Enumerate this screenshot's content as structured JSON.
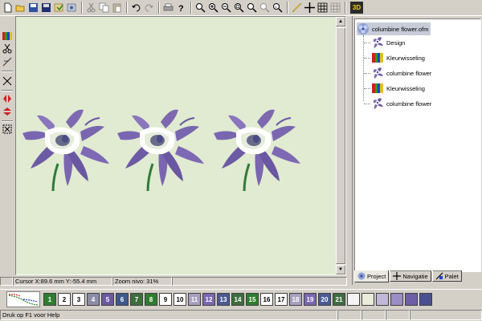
{
  "toolbar": {
    "buttons": [
      "new-icon",
      "open-icon",
      "save-as-icon",
      "save-icon",
      "import-icon",
      "export-icon",
      "cut-icon",
      "copy-icon",
      "paste-icon",
      "undo-icon",
      "redo-icon",
      "print-icon",
      "help-icon",
      "zoom-in-icon",
      "zoom-plus-icon",
      "zoom-minus-icon",
      "zoom-window-icon",
      "zoom-fit-icon",
      "zoom-all-icon",
      "zoom-100-icon",
      "ruler-icon",
      "crosshair-icon",
      "grid-icon",
      "hoop-icon"
    ],
    "label_3d": "3D"
  },
  "canvas": {
    "background": "#e0ebd1",
    "flowers": [
      "columbine flower",
      "columbine flower",
      "columbine flower"
    ]
  },
  "status": {
    "cursor": "Cursor X:89.6 mm Y:-55.4 mm",
    "zoom": "Zoom nivo: 31%"
  },
  "project_panel": {
    "root": "columbine flower.ofm",
    "items": [
      {
        "label": "Design",
        "icon": "flower-icon"
      },
      {
        "label": "Kleurwisseling",
        "icon": "color-change-icon"
      },
      {
        "label": "columbine flower",
        "icon": "flower-icon"
      },
      {
        "label": "Kleurwisseling",
        "icon": "color-change-icon"
      },
      {
        "label": "columbine flower",
        "icon": "flower-icon"
      }
    ],
    "tabs": [
      {
        "label": "Project",
        "active": true
      },
      {
        "label": "Navigatie",
        "active": false
      },
      {
        "label": "Palet",
        "active": false
      }
    ]
  },
  "palette": {
    "swatches": [
      {
        "num": "1",
        "color": "#2f7d2f",
        "text": "#ffffff"
      },
      {
        "num": "2",
        "color": "#ffffff",
        "text": "#000000"
      },
      {
        "num": "3",
        "color": "#ffffff",
        "text": "#000000"
      },
      {
        "num": "4",
        "color": "#8c8ca8",
        "text": "#ffffff"
      },
      {
        "num": "5",
        "color": "#6a5aa0",
        "text": "#ffffff"
      },
      {
        "num": "6",
        "color": "#3e5a8c",
        "text": "#ffffff"
      },
      {
        "num": "7",
        "color": "#3e6e3e",
        "text": "#ffffff"
      },
      {
        "num": "8",
        "color": "#2f7d2f",
        "text": "#ffffff"
      },
      {
        "num": "9",
        "color": "#ffffff",
        "text": "#000000"
      },
      {
        "num": "10",
        "color": "#ffffff",
        "text": "#000000"
      },
      {
        "num": "11",
        "color": "#a8a0c0",
        "text": "#ffffff"
      },
      {
        "num": "12",
        "color": "#7a68b0",
        "text": "#ffffff"
      },
      {
        "num": "13",
        "color": "#4a5a94",
        "text": "#ffffff"
      },
      {
        "num": "14",
        "color": "#3e6e3e",
        "text": "#ffffff"
      },
      {
        "num": "15",
        "color": "#2f7d2f",
        "text": "#ffffff"
      },
      {
        "num": "16",
        "color": "#ffffff",
        "text": "#000000"
      },
      {
        "num": "17",
        "color": "#ffffff",
        "text": "#000000"
      },
      {
        "num": "18",
        "color": "#a8a0c0",
        "text": "#ffffff"
      },
      {
        "num": "19",
        "color": "#7a68b0",
        "text": "#ffffff"
      },
      {
        "num": "20",
        "color": "#4a5a94",
        "text": "#ffffff"
      },
      {
        "num": "21",
        "color": "#3e6e3e",
        "text": "#ffffff"
      },
      {
        "num": "",
        "color": "#f4f4f4",
        "text": "#000000"
      },
      {
        "num": "",
        "color": "#e8ecd8",
        "text": "#000000"
      },
      {
        "num": "",
        "color": "#c0b8d8",
        "text": "#000000"
      },
      {
        "num": "",
        "color": "#9a8cc4",
        "text": "#000000"
      },
      {
        "num": "",
        "color": "#6e5ea8",
        "text": "#000000"
      },
      {
        "num": "",
        "color": "#4a5090",
        "text": "#000000"
      }
    ]
  },
  "statusbar": {
    "help": "Druk op F1 voor Help"
  }
}
